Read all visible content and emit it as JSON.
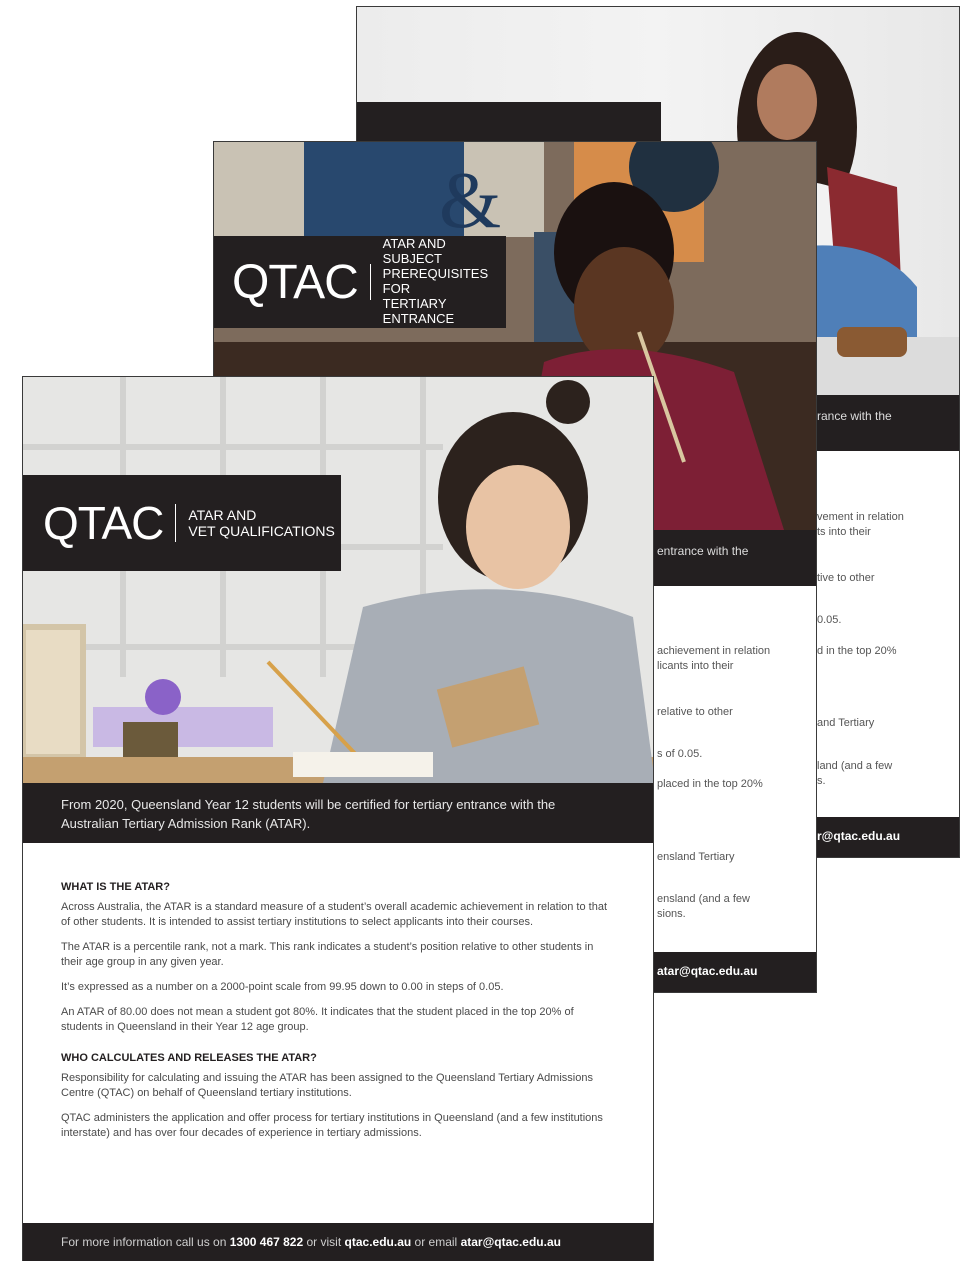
{
  "back": {
    "band_fragment": "rance with the",
    "fragments": [
      "vement in relation",
      "ts into their",
      "tive to other",
      "0.05.",
      "d in the top 20%",
      "and Tertiary",
      "land (and a few",
      "s.",
      "r@qtac.edu.au"
    ]
  },
  "middle": {
    "logo_word": "QTAC",
    "logo_sub": [
      "ATAR AND SUBJECT",
      "PREREQUISITES FOR",
      "TERTIARY ENTRANCE"
    ],
    "band_fragment": "entrance with the",
    "fragments": [
      "achievement in relation",
      "licants into their",
      "relative to other",
      "s of 0.05.",
      "placed in the top 20%",
      "ensland Tertiary",
      "ensland (and a few",
      "sions.",
      "atar@qtac.edu.au"
    ]
  },
  "front": {
    "logo_word": "QTAC",
    "logo_sub": [
      "ATAR AND",
      "VET QUALIFICATIONS"
    ],
    "band_text": "From 2020, Queensland Year 12 students will be certified for tertiary entrance with the Australian Tertiary Admission Rank (ATAR).",
    "sections": [
      {
        "heading": "WHAT IS THE ATAR?",
        "paragraphs": [
          "Across Australia, the ATAR is a standard measure of a student’s overall academic achievement in relation to that of other students. It is intended to assist tertiary institutions to select applicants into their courses.",
          "The ATAR is a percentile rank, not a mark. This rank indicates a student’s position relative to other students in their age group in any given year.",
          "It’s expressed as a number on a 2000-point scale from 99.95 down to 0.00 in steps of 0.05.",
          "An ATAR of 80.00 does not mean a student got 80%. It indicates that the student placed in the top 20% of students in Queensland in their Year 12 age group."
        ]
      },
      {
        "heading": "WHO CALCULATES AND RELEASES THE ATAR?",
        "paragraphs": [
          "Responsibility for calculating and issuing the ATAR has been assigned to the Queensland Tertiary Admissions Centre (QTAC) on behalf of Queensland tertiary institutions.",
          "QTAC administers the application and offer process for tertiary institutions in Queensland (and a few institutions interstate) and has over four decades of experience in tertiary admissions."
        ]
      }
    ],
    "footer": {
      "prefix": "For more information call us on",
      "phone": "1300 467 822",
      "mid1": "or visit",
      "site": "qtac.edu.au",
      "mid2": "or email",
      "email": "atar@qtac.edu.au"
    }
  }
}
